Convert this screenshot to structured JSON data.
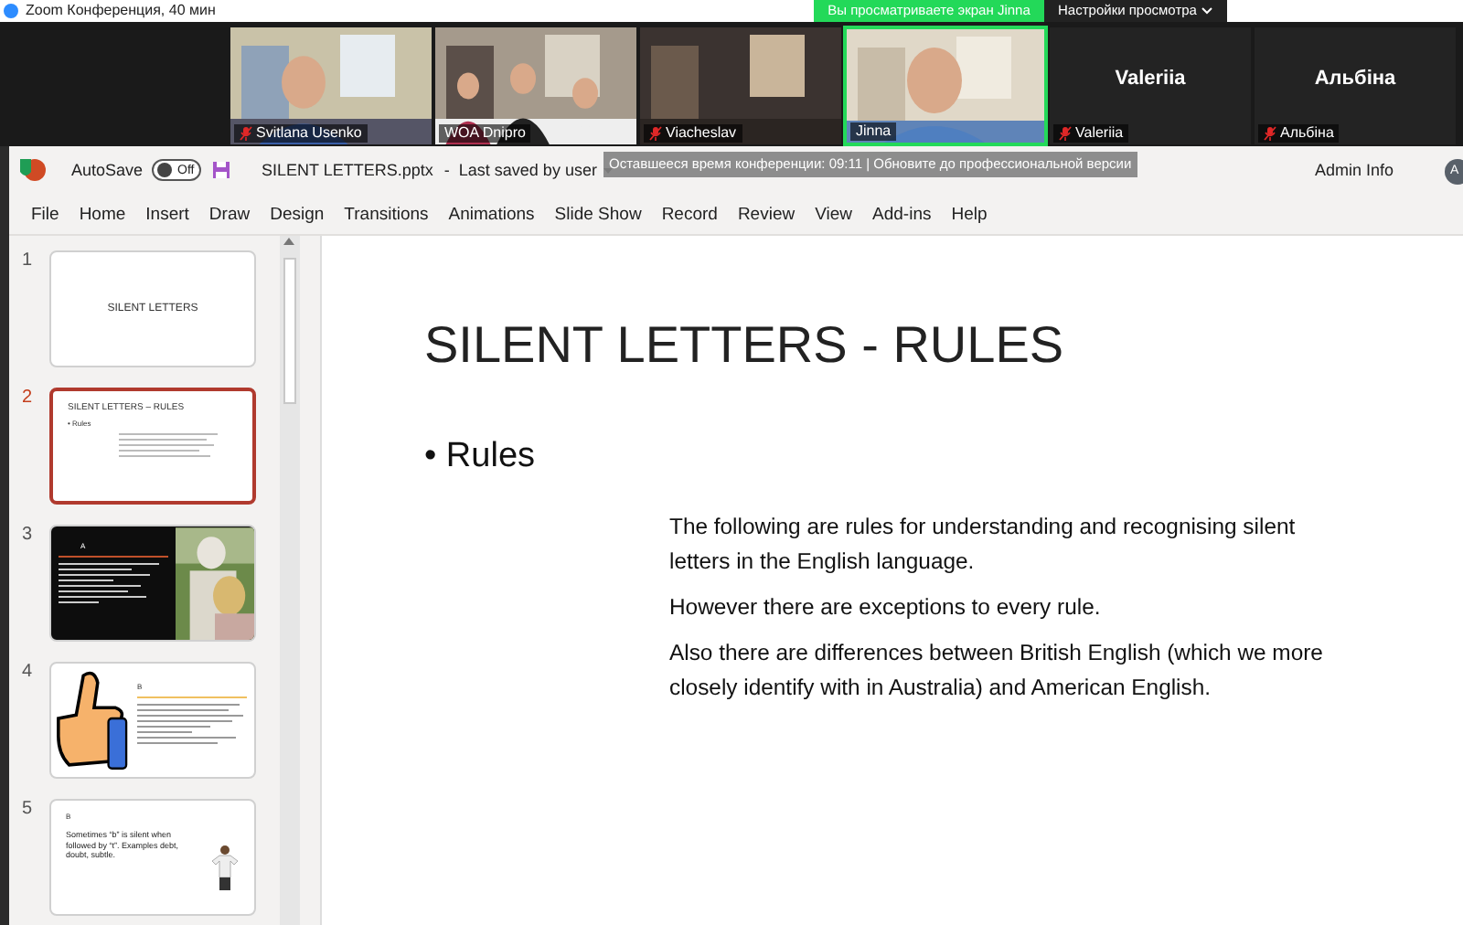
{
  "zoom_bar": {
    "title": "Zoom Конференция, 40 мин",
    "banner": "Вы просматриваете экран Jinna",
    "view_options": "Настройки просмотра"
  },
  "participants": [
    {
      "kind": "video",
      "name": "Svitlana Usenko",
      "muted": true,
      "speaking": false
    },
    {
      "kind": "video",
      "name": "WOA Dnipro",
      "muted": false,
      "speaking": false
    },
    {
      "kind": "video",
      "name": "Viacheslav",
      "muted": true,
      "speaking": false
    },
    {
      "kind": "video",
      "name": "Jinna",
      "muted": false,
      "speaking": true
    },
    {
      "kind": "name",
      "display_name": "Valeriia",
      "name": "Valeriia",
      "muted": true,
      "speaking": false
    },
    {
      "kind": "name",
      "display_name": "Альбіна",
      "name": "Альбіна",
      "muted": true,
      "speaking": false
    }
  ],
  "title_bar": {
    "autosave": {
      "label": "AutoSave",
      "on": false,
      "state_text": "Off"
    },
    "file_name": "SILENT LETTERS.pptx",
    "separator": "-",
    "save_status": "Last saved by user",
    "account": "Admin Info",
    "avatar_initials": "A"
  },
  "notice": "Оставшееся время конференции: 09:11 | Обновите до профессиональной версии",
  "menu": [
    "File",
    "Home",
    "Insert",
    "Draw",
    "Design",
    "Transitions",
    "Animations",
    "Slide Show",
    "Record",
    "Review",
    "View",
    "Add-ins",
    "Help"
  ],
  "slides": [
    {
      "number": "1",
      "kind": "title",
      "selected": false,
      "title": "SILENT LETTERS"
    },
    {
      "number": "2",
      "kind": "text",
      "selected": true,
      "title": "SILENT LETTERS – RULES",
      "bullet": "• Rules"
    },
    {
      "number": "3",
      "selected": false,
      "title": "A"
    },
    {
      "number": "4",
      "kind": "clipart",
      "selected": false,
      "title": "B"
    },
    {
      "number": "5",
      "kind": "figure",
      "selected": false,
      "title": "B",
      "text": "Sometimes “b” is silent when followed by “t”. Examples debt, doubt, subtle."
    }
  ],
  "current_slide": {
    "title": "SILENT LETTERS - RULES",
    "bullet": "• Rules",
    "paragraphs": [
      "The following are rules for understanding and recognising silent letters in the English language.",
      "However there are exceptions to every rule.",
      "Also there are differences between British English (which we more closely identify with in Australia) and American English."
    ]
  }
}
